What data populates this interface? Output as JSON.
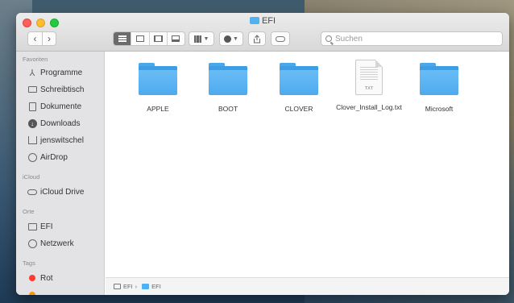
{
  "window": {
    "title": "EFI"
  },
  "toolbar": {
    "back_glyph": "‹",
    "forward_glyph": "›",
    "search_placeholder": "Suchen",
    "icons": [
      "list-view-icon",
      "icon-view-icon",
      "column-view-icon",
      "gallery-view-icon",
      "group-icon",
      "gear-icon",
      "share-icon",
      "tag-icon",
      "search-icon"
    ]
  },
  "sidebar": {
    "favorites_header": "Favoriten",
    "favorites": [
      {
        "label": "Programme",
        "icon": "applications-icon"
      },
      {
        "label": "Schreibtisch",
        "icon": "desktop-icon"
      },
      {
        "label": "Dokumente",
        "icon": "documents-icon"
      },
      {
        "label": "Downloads",
        "icon": "downloads-icon"
      },
      {
        "label": "jenswitschel",
        "icon": "home-icon"
      },
      {
        "label": "AirDrop",
        "icon": "airdrop-icon"
      }
    ],
    "icloud_header": "iCloud",
    "icloud": [
      {
        "label": "iCloud Drive",
        "icon": "cloud-icon"
      }
    ],
    "places_header": "Orte",
    "places": [
      {
        "label": "EFI",
        "icon": "disk-icon"
      },
      {
        "label": "Netzwerk",
        "icon": "network-icon"
      }
    ],
    "tags_header": "Tags",
    "tags": [
      {
        "label": "Rot",
        "color": "#ff3b30"
      }
    ]
  },
  "files": [
    {
      "name": "APPLE",
      "kind": "folder"
    },
    {
      "name": "BOOT",
      "kind": "folder"
    },
    {
      "name": "CLOVER",
      "kind": "folder"
    },
    {
      "name": "Clover_Install_Log.txt",
      "kind": "txt",
      "ext_label": "TXT"
    },
    {
      "name": "Microsoft",
      "kind": "folder"
    }
  ],
  "pathbar": {
    "parts": [
      "EFI",
      "EFI"
    ],
    "separator": "›"
  },
  "colors": {
    "folder": "#52b1f0",
    "tag_red": "#ff3b30"
  }
}
